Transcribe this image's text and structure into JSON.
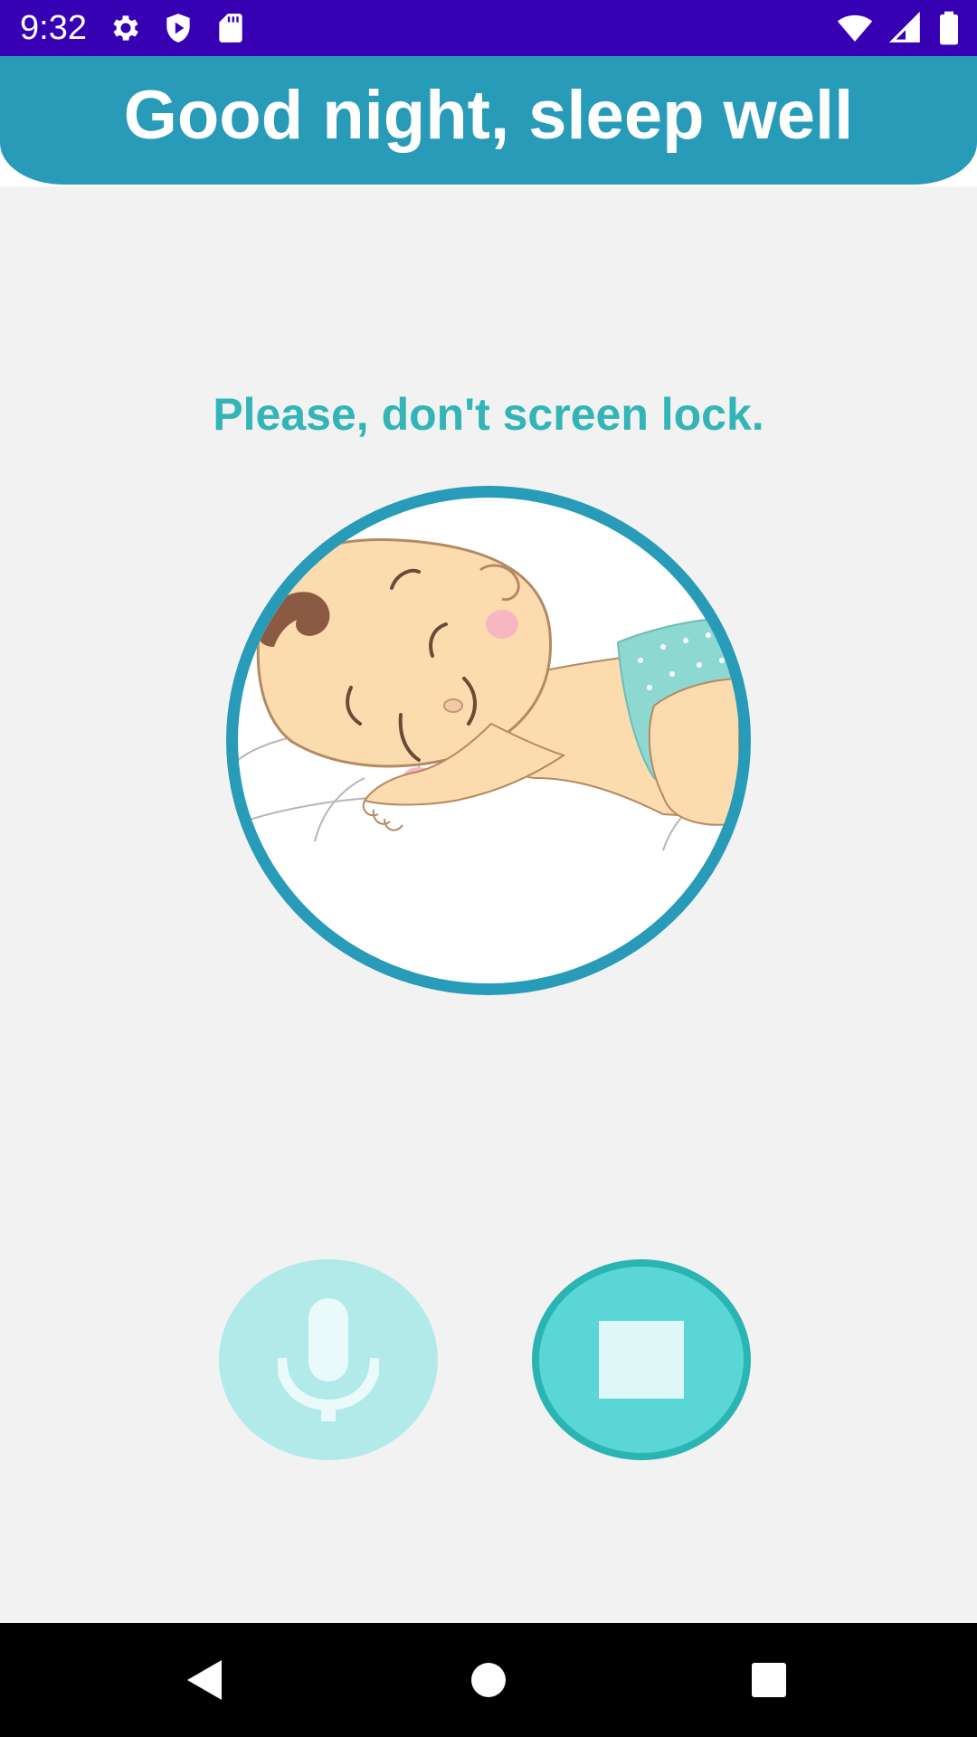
{
  "status_bar": {
    "time": "9:32",
    "left_icons": [
      "gear-icon",
      "shield-play-icon",
      "sd-card-icon"
    ],
    "right_icons": [
      "wifi-icon",
      "cell-signal-icon",
      "battery-icon"
    ]
  },
  "header": {
    "title": "Good night, sleep well"
  },
  "main": {
    "message": "Please, don't screen lock.",
    "illustration": "sleeping-baby"
  },
  "controls": {
    "mic_icon": "microphone-icon",
    "stop_icon": "stop-icon"
  },
  "nav_bar": {
    "icons": [
      "back-icon",
      "home-icon",
      "recents-icon"
    ]
  },
  "colors": {
    "status_bar": "#3700b3",
    "header": "#279bb8",
    "message_text": "#33b5b7",
    "mic_button": "#b2eaea",
    "stop_button": "#5bd6d6",
    "background": "#f2f2f2"
  }
}
